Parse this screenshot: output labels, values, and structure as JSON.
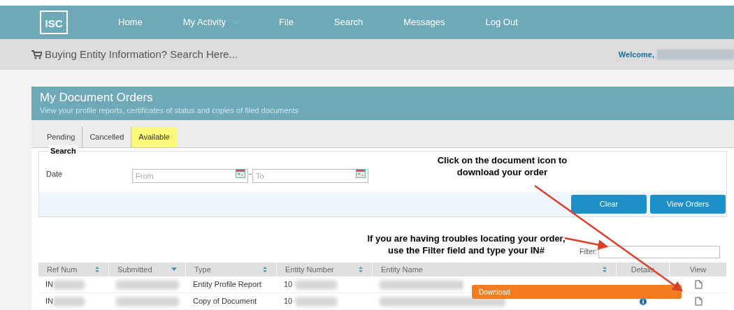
{
  "nav": {
    "logo": "ISC",
    "items": [
      {
        "label": "Home",
        "dropdown": false
      },
      {
        "label": "My Activity",
        "dropdown": true
      },
      {
        "label": "File",
        "dropdown": false
      },
      {
        "label": "Search",
        "dropdown": false
      },
      {
        "label": "Messages",
        "dropdown": false
      },
      {
        "label": "Log Out",
        "dropdown": false
      }
    ]
  },
  "search_bar": {
    "text": "Buying Entity Information? Search Here...",
    "welcome": "Welcome,"
  },
  "panel": {
    "title": "My Document Orders",
    "subtitle": "View your profile reports, certificates of status and copies of filed documents"
  },
  "tabs": [
    {
      "label": "Pending",
      "selected": false
    },
    {
      "label": "Cancelled",
      "selected": false
    },
    {
      "label": "Available",
      "selected": true
    }
  ],
  "search": {
    "legend": "Search",
    "date_label": "Date",
    "from": {
      "placeholder": "From"
    },
    "to": {
      "placeholder": "To"
    },
    "buttons": [
      "Clear",
      "View Orders"
    ]
  },
  "callouts": [
    "Click on the document icon to download your order",
    "If you are having troubles locating your order, use the Filter field and type your IN#"
  ],
  "filter": {
    "label": "Filter:"
  },
  "table": {
    "columns": [
      {
        "label": "Ref Num",
        "kind": "sortable"
      },
      {
        "label": "Submitted",
        "kind": "sorted"
      },
      {
        "label": "Type",
        "kind": "sortable"
      },
      {
        "label": "Entity Number",
        "kind": "sortable"
      },
      {
        "label": "Entity Name",
        "kind": "sortable"
      },
      {
        "label": "Details",
        "kind": "plain"
      },
      {
        "label": "View",
        "kind": "plain"
      }
    ],
    "rows": [
      {
        "ref": "IN",
        "type": "Entity Profile Report",
        "entity_number": "10",
        "details": false
      },
      {
        "ref": "IN",
        "type": "Copy of Document",
        "entity_number": "10",
        "details": true
      }
    ]
  },
  "tooltip": {
    "text": "Download"
  }
}
